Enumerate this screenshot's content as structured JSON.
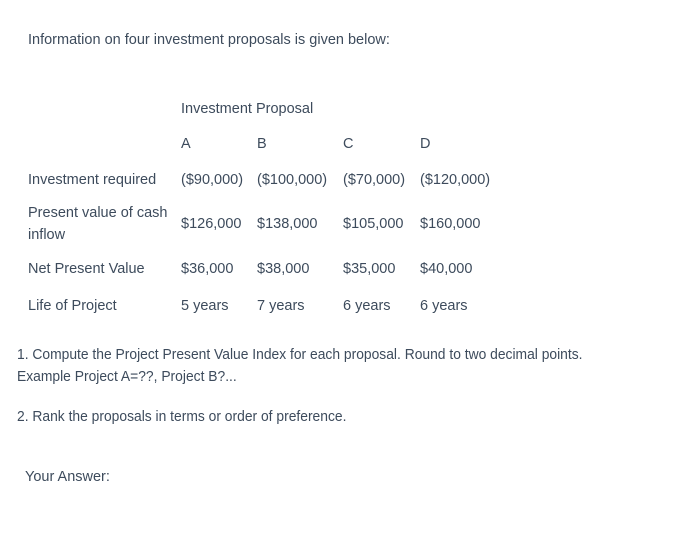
{
  "document": {
    "intro": "Information on four investment proposals is given below:",
    "your_answer_label": "Your Answer:"
  },
  "table": {
    "group_header": "Investment Proposal",
    "columns": [
      "A",
      "B",
      "C",
      "D"
    ],
    "rows": [
      {
        "label": "Investment required",
        "values": [
          "($90,000)",
          "($100,000)",
          "($70,000)",
          "($120,000)"
        ]
      },
      {
        "label": "Present value of cash inflow",
        "values": [
          "$126,000",
          "$138,000",
          "$105,000",
          "$160,000"
        ]
      },
      {
        "label": "Net Present Value",
        "values": [
          "$36,000",
          "$38,000",
          "$35,000",
          "$40,000"
        ]
      },
      {
        "label": "Life of Project",
        "values": [
          "5 years",
          "7 years",
          "6 years",
          "6 years"
        ]
      }
    ]
  },
  "questions": [
    {
      "number": "1.",
      "text": "1.  Compute the Project Present Value Index for each proposal.  Round to two decimal points. Example Project A=??, Project B?..."
    },
    {
      "number": "2.",
      "text": "2.  Rank the proposals in terms or order of preference."
    }
  ],
  "colors": {
    "text": "#3d4b5c",
    "background": "#ffffff"
  }
}
